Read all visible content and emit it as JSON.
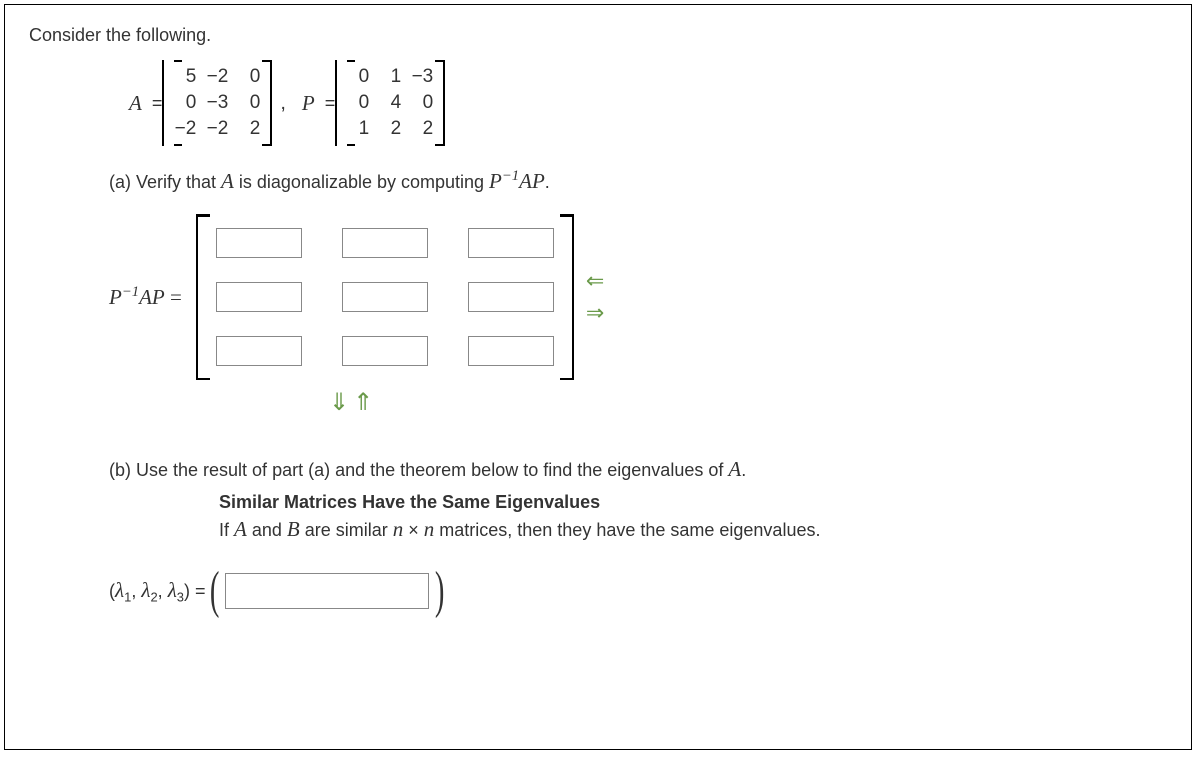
{
  "intro": "Consider the following.",
  "labelA": "A",
  "eq": " = ",
  "labelP": "P",
  "comma": ",",
  "matrixA": [
    [
      "5",
      "−2",
      "0"
    ],
    [
      "0",
      "−3",
      "0"
    ],
    [
      "−2",
      "−2",
      "2"
    ]
  ],
  "matrixP": [
    [
      "0",
      "1",
      "−3"
    ],
    [
      "0",
      "4",
      "0"
    ],
    [
      "1",
      "2",
      "2"
    ]
  ],
  "partA_prefix": "(a) Verify that ",
  "partA_A": "A",
  "partA_mid": " is diagonalizable by computing ",
  "partA_expr_P": "P",
  "partA_expr_neg1": "−1",
  "partA_expr_AP": "AP",
  "period": ".",
  "ansLabel_P": "P",
  "ansLabel_neg1": "−1",
  "ansLabel_AP": "AP",
  "ansLabel_eq": " = ",
  "arrow_left": "⇐",
  "arrow_right": "⇒",
  "arrow_down": "⇓",
  "arrow_up": "⇑",
  "partB_prefix": "(b) Use the result of part (a) and the theorem below to find the eigenvalues of ",
  "partB_A": "A",
  "theorem_title": "Similar Matrices Have the Same Eigenvalues",
  "theorem_if": "If ",
  "theorem_A": "A",
  "theorem_and": " and ",
  "theorem_B": "B",
  "theorem_mid": " are similar ",
  "theorem_n1": "n",
  "theorem_times": " × ",
  "theorem_n2": "n",
  "theorem_end": " matrices, then they have the same eigenvalues.",
  "eig_open": "(",
  "eig_l": "λ",
  "eig_1": "1",
  "eig_2": "2",
  "eig_3": "3",
  "eig_c": ", ",
  "eig_close": ")",
  "eig_eq": " = ",
  "paren_open": "(",
  "paren_close": ")"
}
